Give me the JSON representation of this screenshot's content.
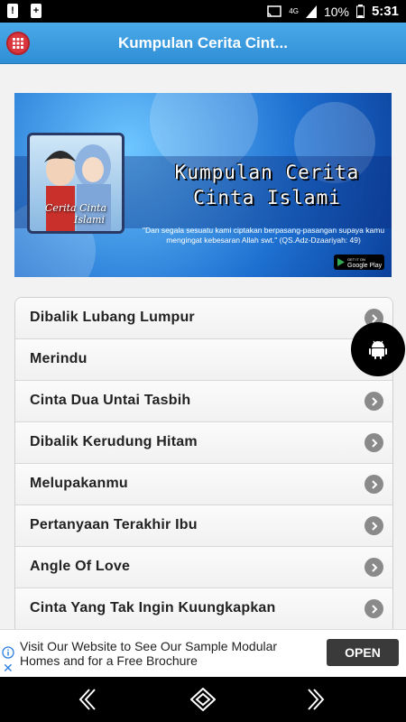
{
  "status_bar": {
    "battery_percent": "10%",
    "time": "5:31",
    "network": "4G"
  },
  "app_bar": {
    "title": "Kumpulan Cerita Cint..."
  },
  "banner": {
    "cover_label_line1": "Cerita Cinta",
    "cover_label_line2": "Islami",
    "title_line1": "Kumpulan Cerita",
    "title_line2": "Cinta Islami",
    "quote": "\"Dan segala sesuatu kami ciptakan berpasang-pasangan supaya kamu mengingat kebesaran Allah swt.\" (QS.Adz-Dzaariyah: 49)",
    "store_badge_small": "GET IT ON",
    "store_badge": "Google Play"
  },
  "stories": [
    {
      "label": "Dibalik Lubang Lumpur"
    },
    {
      "label": "Merindu"
    },
    {
      "label": "Cinta Dua Untai Tasbih"
    },
    {
      "label": "Dibalik Kerudung Hitam"
    },
    {
      "label": "Melupakanmu"
    },
    {
      "label": "Pertanyaan Terakhir Ibu"
    },
    {
      "label": "Angle Of Love"
    },
    {
      "label": "Cinta Yang Tak Ingin Kuungkapkan"
    }
  ],
  "ad": {
    "text": "Visit Our Website to See Our Sample Modular Homes and for a Free Brochure",
    "button": "OPEN"
  },
  "icons": {
    "menu": "apps-grid-icon",
    "fab": "android-icon",
    "chevron": "chevron-right-icon",
    "nav_back": "back-icon",
    "nav_home": "home-icon",
    "nav_recents": "recents-icon"
  },
  "colors": {
    "app_bar": "#3a9ee0",
    "menu_button": "#d9363e",
    "fab": "#000000"
  }
}
